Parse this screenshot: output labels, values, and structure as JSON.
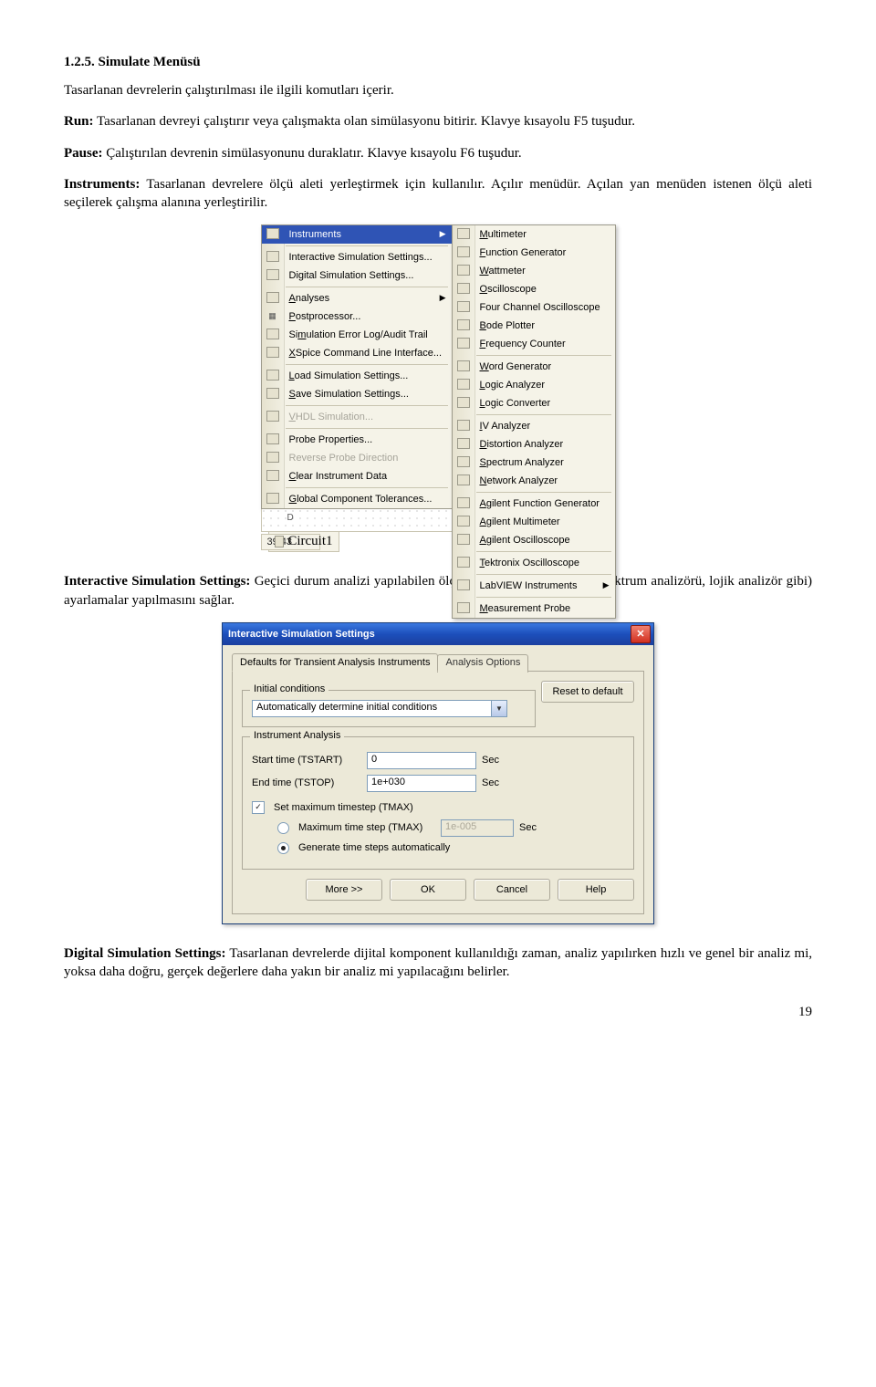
{
  "section_heading": "1.2.5. Simulate Menüsü",
  "intro": "Tasarlanan devrelerin çalıştırılması ile ilgili komutları içerir.",
  "run_label": "Run:",
  "run_text": " Tasarlanan devreyi çalıştırır veya çalışmakta olan simülasyonu bitirir. Klavye kısayolu F5 tuşudur.",
  "pause_label": "Pause:",
  "pause_text": " Çalıştırılan devrenin simülasyonunu duraklatır. Klavye kısayolu F6 tuşudur.",
  "instruments_label": "Instruments:",
  "instruments_text": " Tasarlanan devrelere ölçü aleti yerleştirmek için kullanılır. Açılır menüdür. Açılan yan menüden istenen ölçü aleti seçilerek çalışma alanına yerleştirilir.",
  "iss_label": "Interactive Simulation Settings:",
  "iss_text": " Geçici durum analizi yapılabilen ölçü aletleri için (osilaskop, spektrum analizörü, lojik analizör gibi) ayarlamalar yapılmasını sağlar.",
  "dss_label": "Digital Simulation Settings:",
  "dss_text": " Tasarlanan devrelerde dijital komponent kullanıldığı zaman, analiz yapılırken hızlı ve genel bir analiz mi, yoksa daha doğru, gerçek değerlere daha yakın bir analiz mi yapılacağını belirler.",
  "page_number": "19",
  "menu_left": [
    {
      "label": "Instruments",
      "hl": true,
      "arrow": true
    },
    {
      "sep": true
    },
    {
      "label": "Interactive Simulation Settings..."
    },
    {
      "label": "Digital Simulation Settings..."
    },
    {
      "sep": true
    },
    {
      "label": "Analyses",
      "arrow": true,
      "ul": "A"
    },
    {
      "label": "Postprocessor...",
      "icon": "▦",
      "ul": "P"
    },
    {
      "label": "Simulation Error Log/Audit Trail",
      "ul": "m"
    },
    {
      "label": "XSpice Command Line Interface...",
      "ul": "X"
    },
    {
      "sep": true
    },
    {
      "label": "Load Simulation Settings...",
      "ul": "L"
    },
    {
      "label": "Save Simulation Settings...",
      "ul": "S"
    },
    {
      "sep": true
    },
    {
      "label": "VHDL Simulation...",
      "disabled": true,
      "ul": "V"
    },
    {
      "sep": true
    },
    {
      "label": "Probe Properties..."
    },
    {
      "label": "Reverse Probe Direction",
      "disabled": true
    },
    {
      "label": "Clear Instrument Data",
      "ul": "C"
    },
    {
      "sep": true
    },
    {
      "label": "Global Component Tolerances...",
      "ul": "G"
    }
  ],
  "menu_right": [
    {
      "label": "Multimeter",
      "ul": "M"
    },
    {
      "label": "Function Generator",
      "ul": "F"
    },
    {
      "label": "Wattmeter",
      "ul": "W"
    },
    {
      "label": "Oscilloscope",
      "ul": "O"
    },
    {
      "label": "Four Channel Oscilloscope"
    },
    {
      "label": "Bode Plotter",
      "ul": "B"
    },
    {
      "label": "Frequency Counter",
      "ul": "F"
    },
    {
      "sep": true
    },
    {
      "label": "Word Generator",
      "ul": "W"
    },
    {
      "label": "Logic Analyzer",
      "ul": "L"
    },
    {
      "label": "Logic Converter",
      "ul": "L"
    },
    {
      "sep": true
    },
    {
      "label": "IV Analyzer",
      "ul": "I"
    },
    {
      "label": "Distortion Analyzer",
      "ul": "D"
    },
    {
      "label": "Spectrum Analyzer",
      "ul": "S"
    },
    {
      "label": "Network Analyzer",
      "ul": "N"
    },
    {
      "sep": true
    },
    {
      "label": "Agilent Function Generator",
      "ul": "A"
    },
    {
      "label": "Agilent Multimeter",
      "ul": "A"
    },
    {
      "label": "Agilent Oscilloscope",
      "ul": "A"
    },
    {
      "sep": true
    },
    {
      "label": "Tektronix Oscilloscope",
      "ul": "T"
    },
    {
      "sep": true
    },
    {
      "label": "LabVIEW Instruments",
      "arrow": true
    },
    {
      "sep": true
    },
    {
      "label": "Measurement Probe",
      "ul": "M"
    }
  ],
  "status_time": "39:43",
  "status_circuit": "Circuit1",
  "dotted_label": "D",
  "dialog": {
    "title": "Interactive Simulation Settings",
    "tab1": "Defaults for Transient Analysis Instruments",
    "tab2": "Analysis Options",
    "reset": "Reset to default",
    "group_initial": "Initial conditions",
    "dd_text": "Automatically determine initial conditions",
    "group_inst": "Instrument Analysis",
    "start_label": "Start time (TSTART)",
    "start_val": "0",
    "end_label": "End time (TSTOP)",
    "end_val": "1e+030",
    "unit": "Sec",
    "chk_label": "Set maximum timestep (TMAX)",
    "opt1": "Maximum time step (TMAX)",
    "opt1_val": "1e-005",
    "opt2": "Generate time steps automatically",
    "btn_more": "More >>",
    "btn_ok": "OK",
    "btn_cancel": "Cancel",
    "btn_help": "Help"
  }
}
